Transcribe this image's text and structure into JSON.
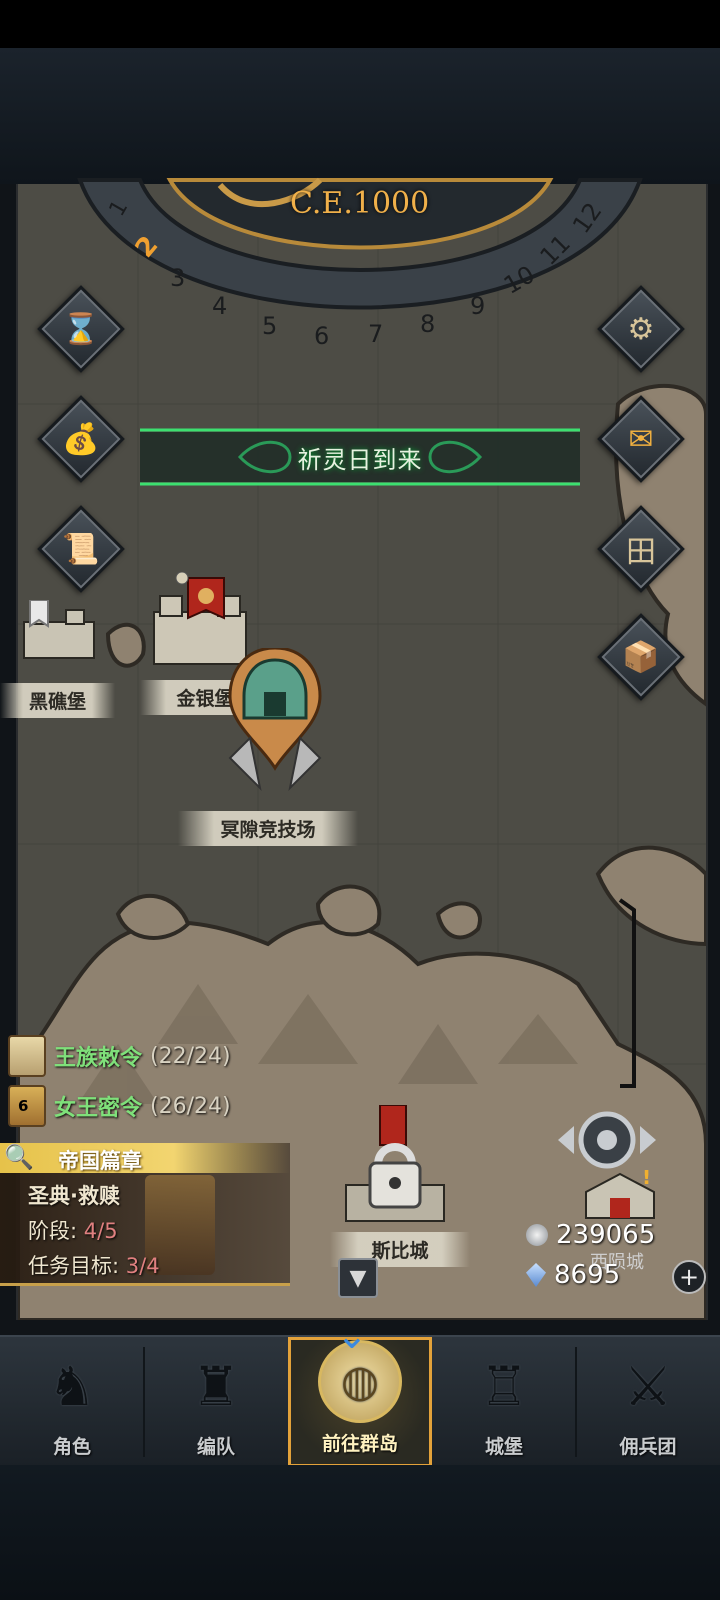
{
  "calendar": {
    "era": "C.E.1000",
    "months": [
      "1",
      "2",
      "3",
      "4",
      "5",
      "6",
      "7",
      "8",
      "9",
      "10",
      "11",
      "12"
    ],
    "current_month": "2"
  },
  "left_buttons": [
    {
      "icon": "hourglass-icon"
    },
    {
      "icon": "money-bag-icon"
    },
    {
      "icon": "scroll-icon"
    }
  ],
  "right_buttons": [
    {
      "icon": "settings-icon"
    },
    {
      "icon": "mail-icon"
    },
    {
      "icon": "frame-icon"
    },
    {
      "icon": "chest-icon"
    }
  ],
  "event_banner": {
    "text": "祈灵日到来"
  },
  "locations": {
    "black_reef": "黑礁堡",
    "gold_silver": "金银堡",
    "arena": "冥隙竞技场",
    "locked_city": "斯比城",
    "west_city": "西陨城"
  },
  "quests": [
    {
      "name": "王族敕令",
      "count": "(22/24)"
    },
    {
      "name": "女王密令",
      "count": "(26/24)",
      "badge": "6"
    }
  ],
  "chapter_panel": {
    "header": "帝国篇章",
    "title": "圣典·救赎",
    "stage_label": "阶段:",
    "stage_value": "4/5",
    "goal_label": "任务目标:",
    "goal_value": "3/4"
  },
  "resources": {
    "silver": "239065",
    "crystal": "8695"
  },
  "nav": [
    {
      "label": "角色",
      "icon": "knight-icon"
    },
    {
      "label": "编队",
      "icon": "helmet-icon"
    },
    {
      "label": "前往群岛",
      "icon": "globe-icon",
      "active": true
    },
    {
      "label": "城堡",
      "icon": "castle-icon"
    },
    {
      "label": "佣兵团",
      "icon": "mercenary-icon"
    }
  ],
  "colors": {
    "accent": "#e3a23a",
    "quest_green": "#7fe07a",
    "banner_glow": "#22cc55"
  }
}
